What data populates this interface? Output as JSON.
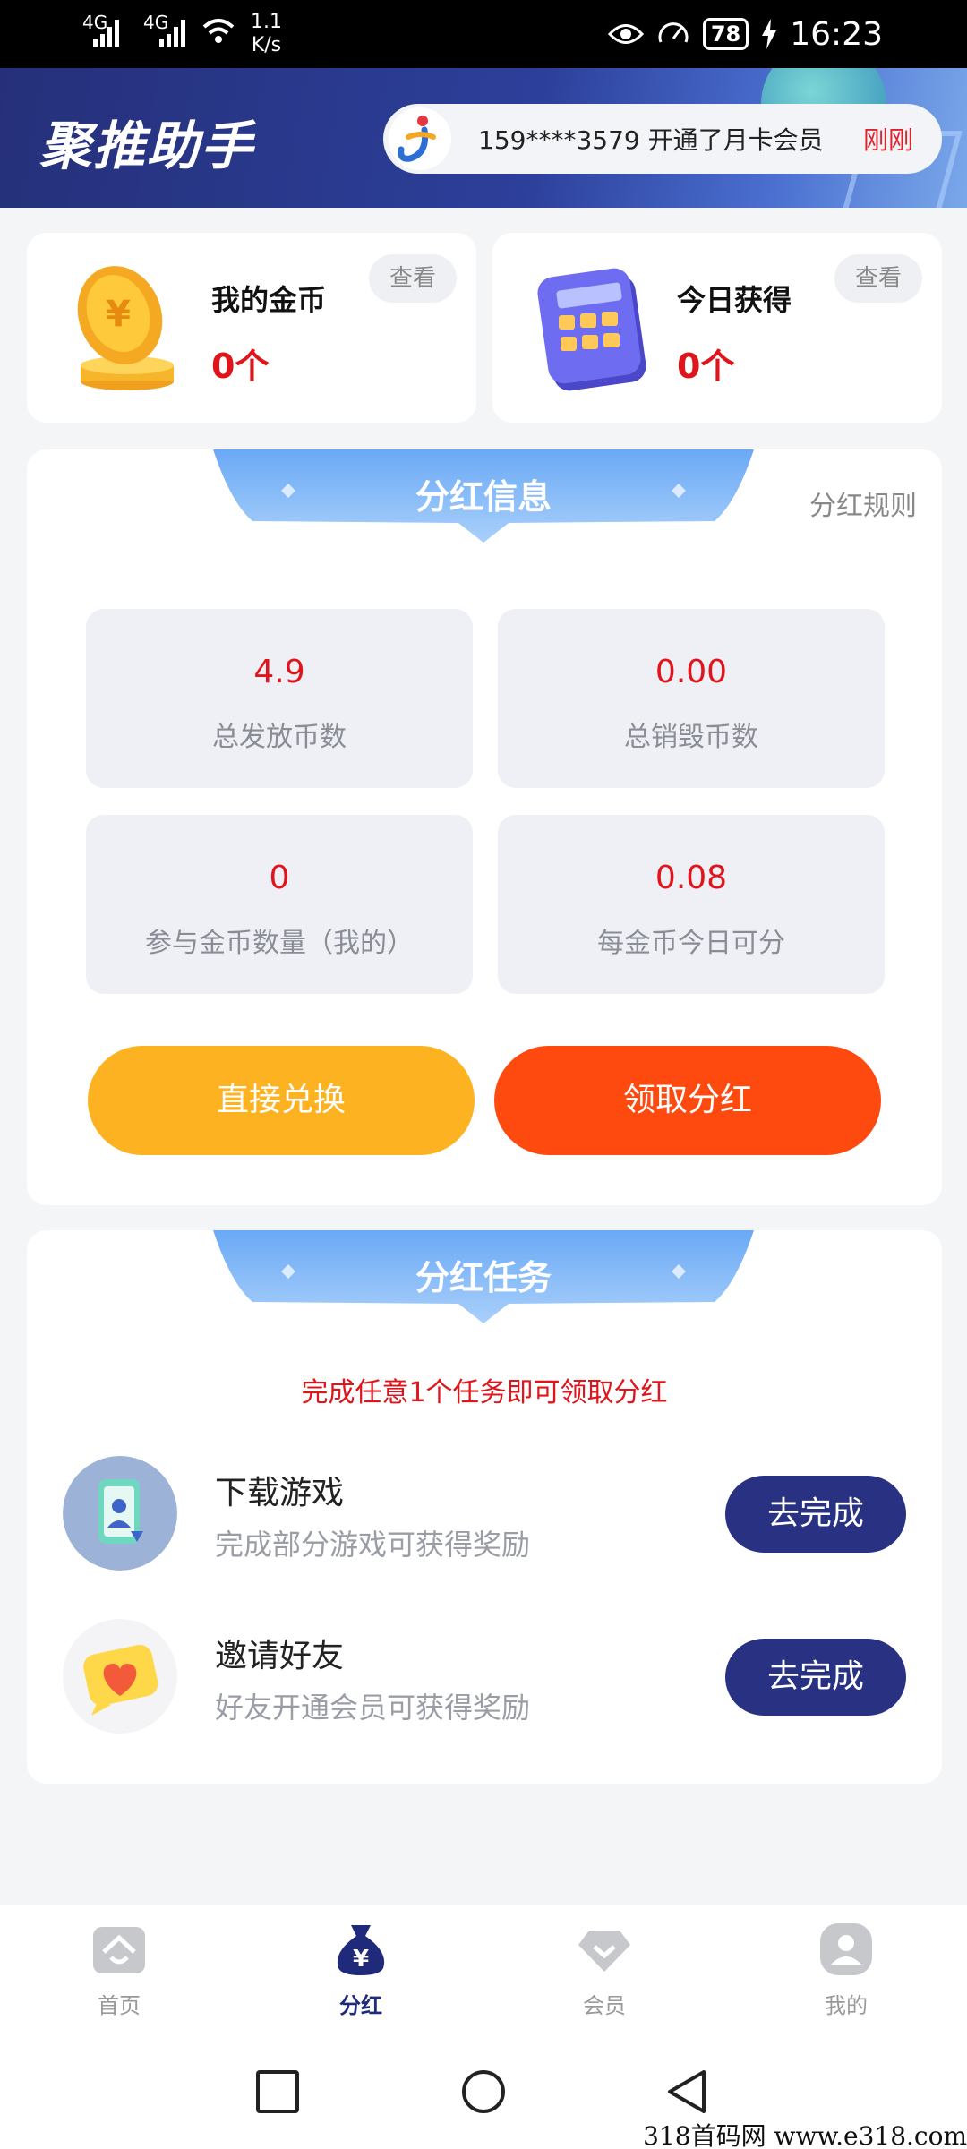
{
  "status_bar": {
    "network_1": "4G",
    "network_2": "4G",
    "speed": "1.1",
    "speed_unit": "K/s",
    "battery": "78",
    "time": "16:23"
  },
  "header": {
    "app_title": "聚推助手",
    "notice_text": "159****3579 开通了月卡会员",
    "notice_time": "刚刚"
  },
  "cards": {
    "coins": {
      "label": "我的金币",
      "value": "0个",
      "view": "查看"
    },
    "today": {
      "label": "今日获得",
      "value": "0个",
      "view": "查看"
    }
  },
  "dividend_info": {
    "title": "分红信息",
    "rules_link": "分红规则",
    "stats": [
      {
        "value": "4.9",
        "caption": "总发放币数"
      },
      {
        "value": "0.00",
        "caption": "总销毁币数"
      },
      {
        "value": "0",
        "caption": "参与金币数量（我的）"
      },
      {
        "value": "0.08",
        "caption": "每金币今日可分"
      }
    ],
    "exchange_button": "直接兑换",
    "claim_button": "领取分红"
  },
  "dividend_tasks": {
    "title": "分红任务",
    "hint": "完成任意1个任务即可领取分红",
    "tasks": [
      {
        "name": "下载游戏",
        "desc": "完成部分游戏可获得奖励",
        "button": "去完成",
        "icon": "phone-user-icon"
      },
      {
        "name": "邀请好友",
        "desc": "好友开通会员可获得奖励",
        "button": "去完成",
        "icon": "heart-chat-icon"
      }
    ]
  },
  "tab_bar": {
    "items": [
      {
        "label": "首页",
        "icon": "home-icon"
      },
      {
        "label": "分红",
        "icon": "money-bag-icon"
      },
      {
        "label": "会员",
        "icon": "diamond-icon"
      },
      {
        "label": "我的",
        "icon": "profile-icon"
      }
    ],
    "active": "分红"
  },
  "watermark": "318首码网  www.e318.com",
  "colors": {
    "accent_red": "#e0151c",
    "exchange_yellow": "#fdb321",
    "claim_orange": "#ff4a0f",
    "task_button_navy": "#283182"
  }
}
